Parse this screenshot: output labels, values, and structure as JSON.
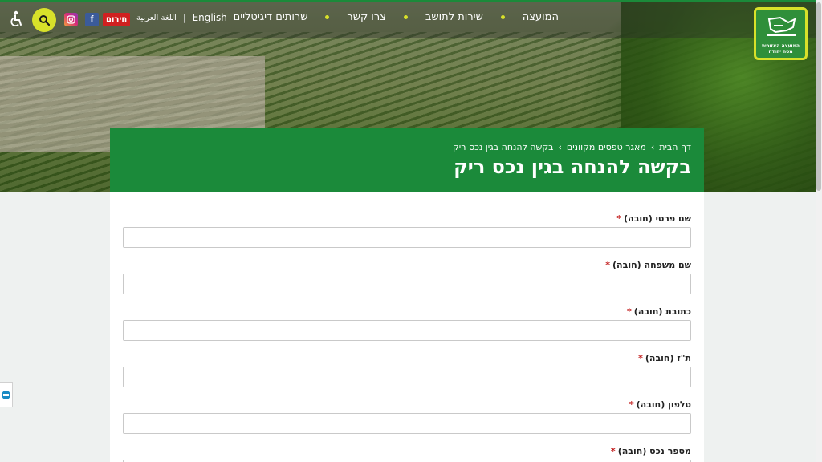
{
  "header": {
    "logo": {
      "text_line1": "המועצה האזורית",
      "text_line2": "מטה יהודה"
    },
    "nav": [
      {
        "label": "המועצה"
      },
      {
        "label": "שירות לתושב"
      },
      {
        "label": "צרו קשר"
      },
      {
        "label": "שרותים דיגיטליים"
      }
    ],
    "lang_english": "English",
    "lang_arabic": "اللغة العربية",
    "emergency_label": "חירום",
    "facebook_glyph": "f",
    "icons": {
      "search": "search-icon",
      "accessibility": "accessibility-icon",
      "instagram": "instagram-icon",
      "facebook": "facebook-icon"
    },
    "colors": {
      "accent": "#d8e12a",
      "brand_green": "#1b8a3a",
      "emergency": "#d02020"
    }
  },
  "banner": {
    "breadcrumbs": [
      {
        "label": "דף הבית"
      },
      {
        "label": "מאגר טפסים מקוונים"
      },
      {
        "label": "בקשה להנחה בגין נכס ריק"
      }
    ],
    "title": "בקשה להנחה בגין נכס ריק"
  },
  "form": {
    "fields": [
      {
        "label": "שם פרטי (חובה)",
        "value": ""
      },
      {
        "label": "שם משפחה (חובה)",
        "value": ""
      },
      {
        "label": "כתובת (חובה)",
        "value": ""
      },
      {
        "label": "ת\"ז (חובה)",
        "value": ""
      },
      {
        "label": "טלפון (חובה)",
        "value": ""
      },
      {
        "label": "מספר נכס (חובה)",
        "value": ""
      }
    ],
    "required_marker": "*"
  }
}
